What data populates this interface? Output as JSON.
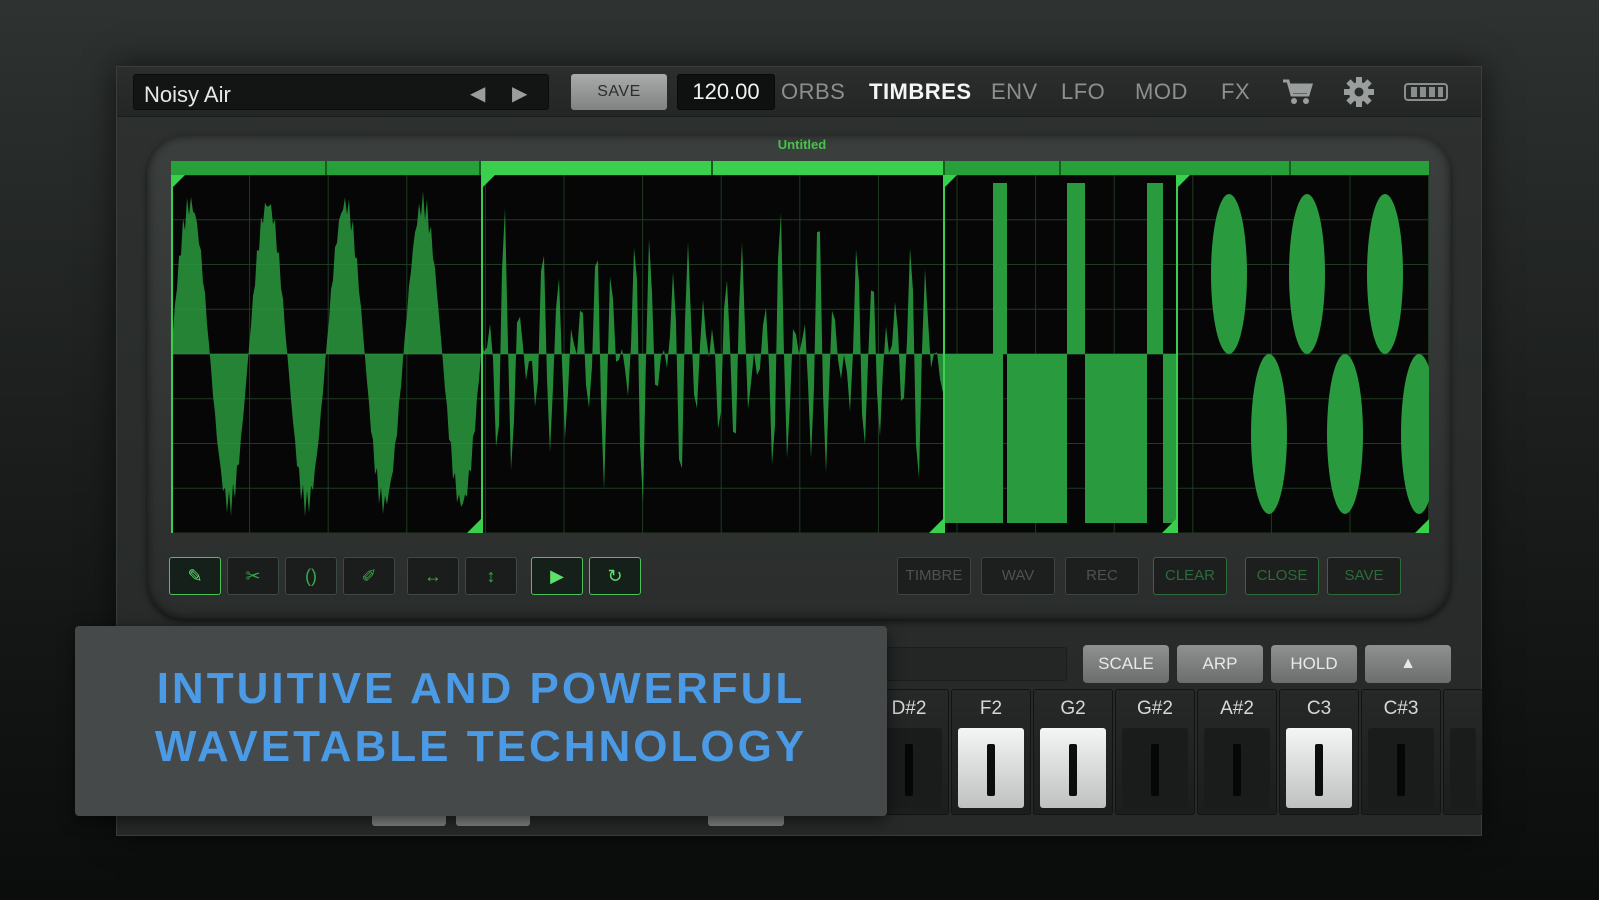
{
  "header": {
    "preset_name": "Noisy Air",
    "prev_icon": "◀",
    "next_icon": "▶",
    "save_label": "SAVE",
    "tempo": "120.00",
    "tabs": [
      "ORBS",
      "TIMBRES",
      "ENV",
      "LFO",
      "MOD",
      "FX"
    ],
    "active_tab": "TIMBRES",
    "icons": [
      "cart-icon",
      "gear-icon",
      "keyboard-toggle-icon"
    ]
  },
  "editor": {
    "title": "Untitled",
    "wave_color": "#2a9a3e",
    "tools": [
      "pencil-icon",
      "scissors-icon",
      "crossfade-icon",
      "brush-icon",
      "spread-icon",
      "vertical-resize-icon",
      "play-icon",
      "loop-icon"
    ],
    "buttons": [
      "TIMBRE",
      "WAV",
      "REC",
      "CLEAR",
      "CLOSE",
      "SAVE"
    ]
  },
  "controls": {
    "scale_label": "SCALE",
    "arp_label": "ARP",
    "hold_label": "HOLD",
    "up_label": "▲"
  },
  "keyboard": {
    "keys": [
      "D#2",
      "F2",
      "G2",
      "G#2",
      "A#2",
      "C3",
      "C#3"
    ],
    "pressed": [
      "F2",
      "G2",
      "C3"
    ]
  },
  "promo": {
    "line1": "INTUITIVE AND POWERFUL",
    "line2": "WAVETABLE TECHNOLOGY"
  },
  "colors": {
    "accent_green": "#3ad04e",
    "promo_text": "#4a9ae6"
  }
}
